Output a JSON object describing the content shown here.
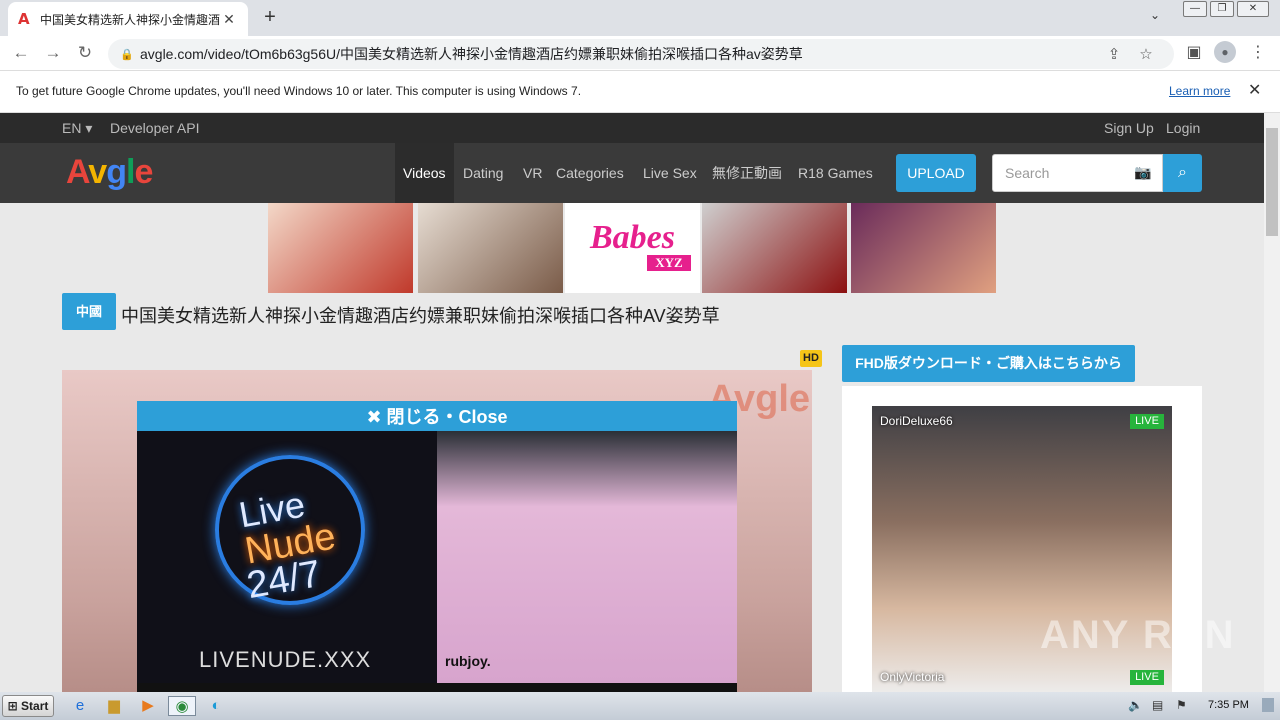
{
  "browser": {
    "tab_title": "中国美女精选新人神探小金情趣酒店",
    "tab_favicon": "avgle-logo",
    "url": "avgle.com/video/tOm6b63g56U/中国美女精选新人神探小金情趣酒店约嫖兼职妹偷拍深喉插口各种av姿势草",
    "infobar_message": "To get future Google Chrome updates, you'll need Windows 10 or later. This computer is using Windows 7.",
    "infobar_link": "Learn more"
  },
  "site": {
    "lang": "EN ▾",
    "dev_api": "Developer API",
    "signup": "Sign Up",
    "login": "Login",
    "logo": "Avgle",
    "nav": [
      "Videos",
      "Dating",
      "VR",
      "Categories",
      "Live Sex",
      "無修正動画",
      "R18 Games"
    ],
    "upload": "UPLOAD",
    "search_placeholder": "Search",
    "ad_brand": "Babes",
    "ad_brand_sub": "XYZ",
    "category_badge": "中國",
    "video_title": "中国美女精选新人神探小金情趣酒店约嫖兼职妹偷拍深喉插口各种AV姿势草",
    "hd_badge": "HD",
    "watermark": "Avgle",
    "popup_close": "✖ 閉じる・Close",
    "popup_line1": "Live",
    "popup_line2": "Nude",
    "popup_line3": "24/7",
    "popup_url": "LIVENUDE.XXX",
    "popup_brand": "rubjoy.",
    "fhd_button": "FHD版ダウンロード・ご購入はこちらから",
    "cam1_name": "DoriDeluxe66",
    "cam2_name": "OnlyVictoria",
    "live_label": "LIVE",
    "anyrun": "ANY RUN"
  },
  "taskbar": {
    "start": "Start",
    "clock": "7:35 PM"
  },
  "colors": {
    "accent": "#2d9fd8",
    "live": "#27b43c",
    "hd": "#f5c518"
  }
}
